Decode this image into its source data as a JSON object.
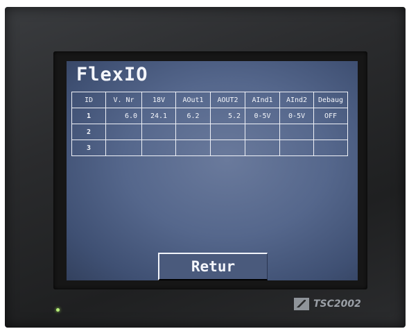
{
  "screen": {
    "title": "FlexIO",
    "table": {
      "headers": [
        "ID",
        "V. Nr",
        "18V",
        "AOut1",
        "AOUT2",
        "AInd1",
        "AInd2",
        "Debaug"
      ],
      "rows": [
        [
          "1",
          "6.0",
          "24.1",
          "6.2",
          "5.2",
          "0-5V",
          "0-5V",
          "OFF"
        ],
        [
          "2",
          "",
          "",
          "",
          "",
          "",
          "",
          ""
        ],
        [
          "3",
          "",
          "",
          "",
          "",
          "",
          "",
          ""
        ]
      ]
    },
    "retur_label": "Retur"
  },
  "device": {
    "brand": "TSC2002",
    "led_color": "#b8f07a"
  },
  "colors": {
    "screen_bg": "#55678c",
    "text": "#f4f6fb",
    "bezel": "#2a2b2d"
  }
}
